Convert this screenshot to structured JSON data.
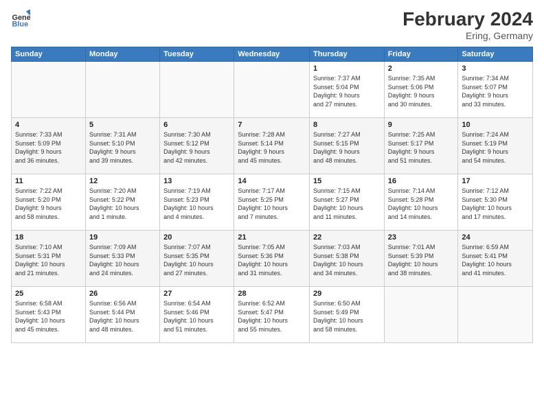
{
  "header": {
    "logo_text_1": "General",
    "logo_text_2": "Blue",
    "month_year": "February 2024",
    "location": "Ering, Germany"
  },
  "weekdays": [
    "Sunday",
    "Monday",
    "Tuesday",
    "Wednesday",
    "Thursday",
    "Friday",
    "Saturday"
  ],
  "weeks": [
    [
      {
        "day": "",
        "info": ""
      },
      {
        "day": "",
        "info": ""
      },
      {
        "day": "",
        "info": ""
      },
      {
        "day": "",
        "info": ""
      },
      {
        "day": "1",
        "info": "Sunrise: 7:37 AM\nSunset: 5:04 PM\nDaylight: 9 hours\nand 27 minutes."
      },
      {
        "day": "2",
        "info": "Sunrise: 7:35 AM\nSunset: 5:06 PM\nDaylight: 9 hours\nand 30 minutes."
      },
      {
        "day": "3",
        "info": "Sunrise: 7:34 AM\nSunset: 5:07 PM\nDaylight: 9 hours\nand 33 minutes."
      }
    ],
    [
      {
        "day": "4",
        "info": "Sunrise: 7:33 AM\nSunset: 5:09 PM\nDaylight: 9 hours\nand 36 minutes."
      },
      {
        "day": "5",
        "info": "Sunrise: 7:31 AM\nSunset: 5:10 PM\nDaylight: 9 hours\nand 39 minutes."
      },
      {
        "day": "6",
        "info": "Sunrise: 7:30 AM\nSunset: 5:12 PM\nDaylight: 9 hours\nand 42 minutes."
      },
      {
        "day": "7",
        "info": "Sunrise: 7:28 AM\nSunset: 5:14 PM\nDaylight: 9 hours\nand 45 minutes."
      },
      {
        "day": "8",
        "info": "Sunrise: 7:27 AM\nSunset: 5:15 PM\nDaylight: 9 hours\nand 48 minutes."
      },
      {
        "day": "9",
        "info": "Sunrise: 7:25 AM\nSunset: 5:17 PM\nDaylight: 9 hours\nand 51 minutes."
      },
      {
        "day": "10",
        "info": "Sunrise: 7:24 AM\nSunset: 5:19 PM\nDaylight: 9 hours\nand 54 minutes."
      }
    ],
    [
      {
        "day": "11",
        "info": "Sunrise: 7:22 AM\nSunset: 5:20 PM\nDaylight: 9 hours\nand 58 minutes."
      },
      {
        "day": "12",
        "info": "Sunrise: 7:20 AM\nSunset: 5:22 PM\nDaylight: 10 hours\nand 1 minute."
      },
      {
        "day": "13",
        "info": "Sunrise: 7:19 AM\nSunset: 5:23 PM\nDaylight: 10 hours\nand 4 minutes."
      },
      {
        "day": "14",
        "info": "Sunrise: 7:17 AM\nSunset: 5:25 PM\nDaylight: 10 hours\nand 7 minutes."
      },
      {
        "day": "15",
        "info": "Sunrise: 7:15 AM\nSunset: 5:27 PM\nDaylight: 10 hours\nand 11 minutes."
      },
      {
        "day": "16",
        "info": "Sunrise: 7:14 AM\nSunset: 5:28 PM\nDaylight: 10 hours\nand 14 minutes."
      },
      {
        "day": "17",
        "info": "Sunrise: 7:12 AM\nSunset: 5:30 PM\nDaylight: 10 hours\nand 17 minutes."
      }
    ],
    [
      {
        "day": "18",
        "info": "Sunrise: 7:10 AM\nSunset: 5:31 PM\nDaylight: 10 hours\nand 21 minutes."
      },
      {
        "day": "19",
        "info": "Sunrise: 7:09 AM\nSunset: 5:33 PM\nDaylight: 10 hours\nand 24 minutes."
      },
      {
        "day": "20",
        "info": "Sunrise: 7:07 AM\nSunset: 5:35 PM\nDaylight: 10 hours\nand 27 minutes."
      },
      {
        "day": "21",
        "info": "Sunrise: 7:05 AM\nSunset: 5:36 PM\nDaylight: 10 hours\nand 31 minutes."
      },
      {
        "day": "22",
        "info": "Sunrise: 7:03 AM\nSunset: 5:38 PM\nDaylight: 10 hours\nand 34 minutes."
      },
      {
        "day": "23",
        "info": "Sunrise: 7:01 AM\nSunset: 5:39 PM\nDaylight: 10 hours\nand 38 minutes."
      },
      {
        "day": "24",
        "info": "Sunrise: 6:59 AM\nSunset: 5:41 PM\nDaylight: 10 hours\nand 41 minutes."
      }
    ],
    [
      {
        "day": "25",
        "info": "Sunrise: 6:58 AM\nSunset: 5:43 PM\nDaylight: 10 hours\nand 45 minutes."
      },
      {
        "day": "26",
        "info": "Sunrise: 6:56 AM\nSunset: 5:44 PM\nDaylight: 10 hours\nand 48 minutes."
      },
      {
        "day": "27",
        "info": "Sunrise: 6:54 AM\nSunset: 5:46 PM\nDaylight: 10 hours\nand 51 minutes."
      },
      {
        "day": "28",
        "info": "Sunrise: 6:52 AM\nSunset: 5:47 PM\nDaylight: 10 hours\nand 55 minutes."
      },
      {
        "day": "29",
        "info": "Sunrise: 6:50 AM\nSunset: 5:49 PM\nDaylight: 10 hours\nand 58 minutes."
      },
      {
        "day": "",
        "info": ""
      },
      {
        "day": "",
        "info": ""
      }
    ]
  ]
}
